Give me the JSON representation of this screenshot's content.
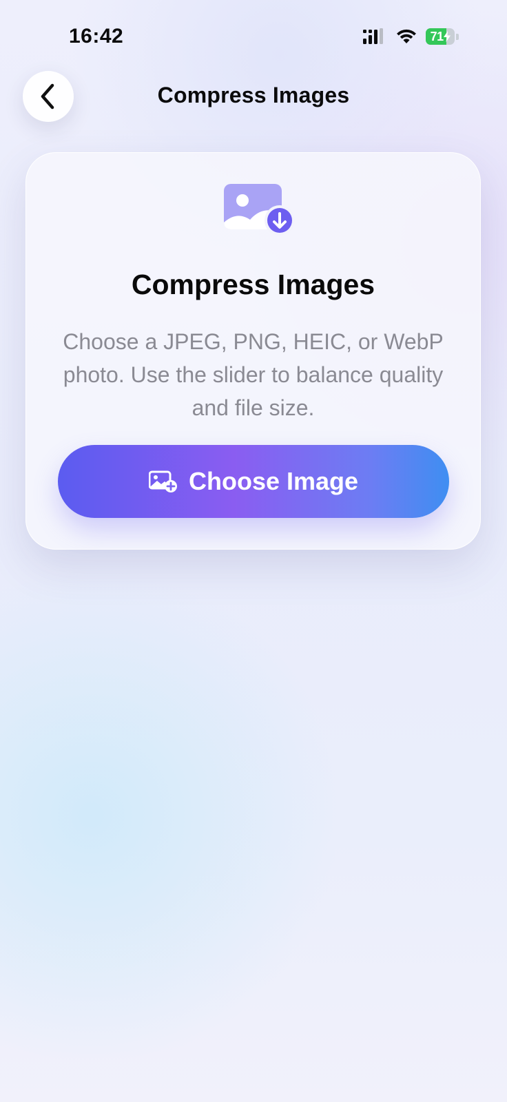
{
  "status_bar": {
    "time": "16:42",
    "battery_label": "71",
    "battery_level": 0.71,
    "battery_color": "#34c759",
    "icons": [
      "cellular-signal-icon",
      "wifi-icon",
      "battery-charging-icon"
    ]
  },
  "nav": {
    "back_icon": "chevron-left-icon",
    "title": "Compress Images"
  },
  "card": {
    "icon": "image-download-icon",
    "title": "Compress Images",
    "description": "Choose a JPEG, PNG, HEIC, or WebP photo. Use the slider to balance quality and file size.",
    "button": {
      "label": "Choose Image",
      "icon": "photo-add-icon",
      "gradient": [
        "#5b5cf0",
        "#8a5df1",
        "#3f8ef2"
      ]
    }
  },
  "colors": {
    "accent": "#6f5ef0",
    "icon_light": "#a8a2f4",
    "text_secondary": "#8a8a93"
  }
}
